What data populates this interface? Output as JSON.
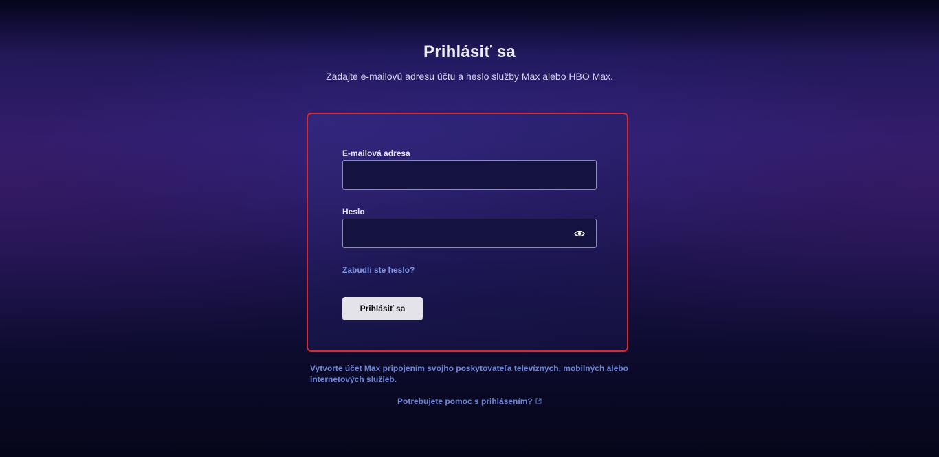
{
  "header": {
    "title": "Prihlásiť sa",
    "subtitle": "Zadajte e-mailovú adresu účtu a heslo služby Max alebo HBO Max."
  },
  "login_form": {
    "email_label": "E-mailová adresa",
    "email_value": "",
    "password_label": "Heslo",
    "password_value": "",
    "password_toggle_icon": "eye-icon",
    "forgot_password_link": "Zabudli ste heslo?",
    "submit_label": "Prihlásiť sa",
    "highlight_border_color": "#d42b34"
  },
  "footer": {
    "create_account_text": "Vytvorte účet Max pripojením svojho poskytovateľa televíznych, mobilných alebo internetových služieb.",
    "help_link": "Potrebujete pomoc s prihlásením?",
    "help_link_icon": "external-link-icon"
  },
  "colors": {
    "link": "#7e95e6",
    "button_bg": "#e4e3ea"
  }
}
